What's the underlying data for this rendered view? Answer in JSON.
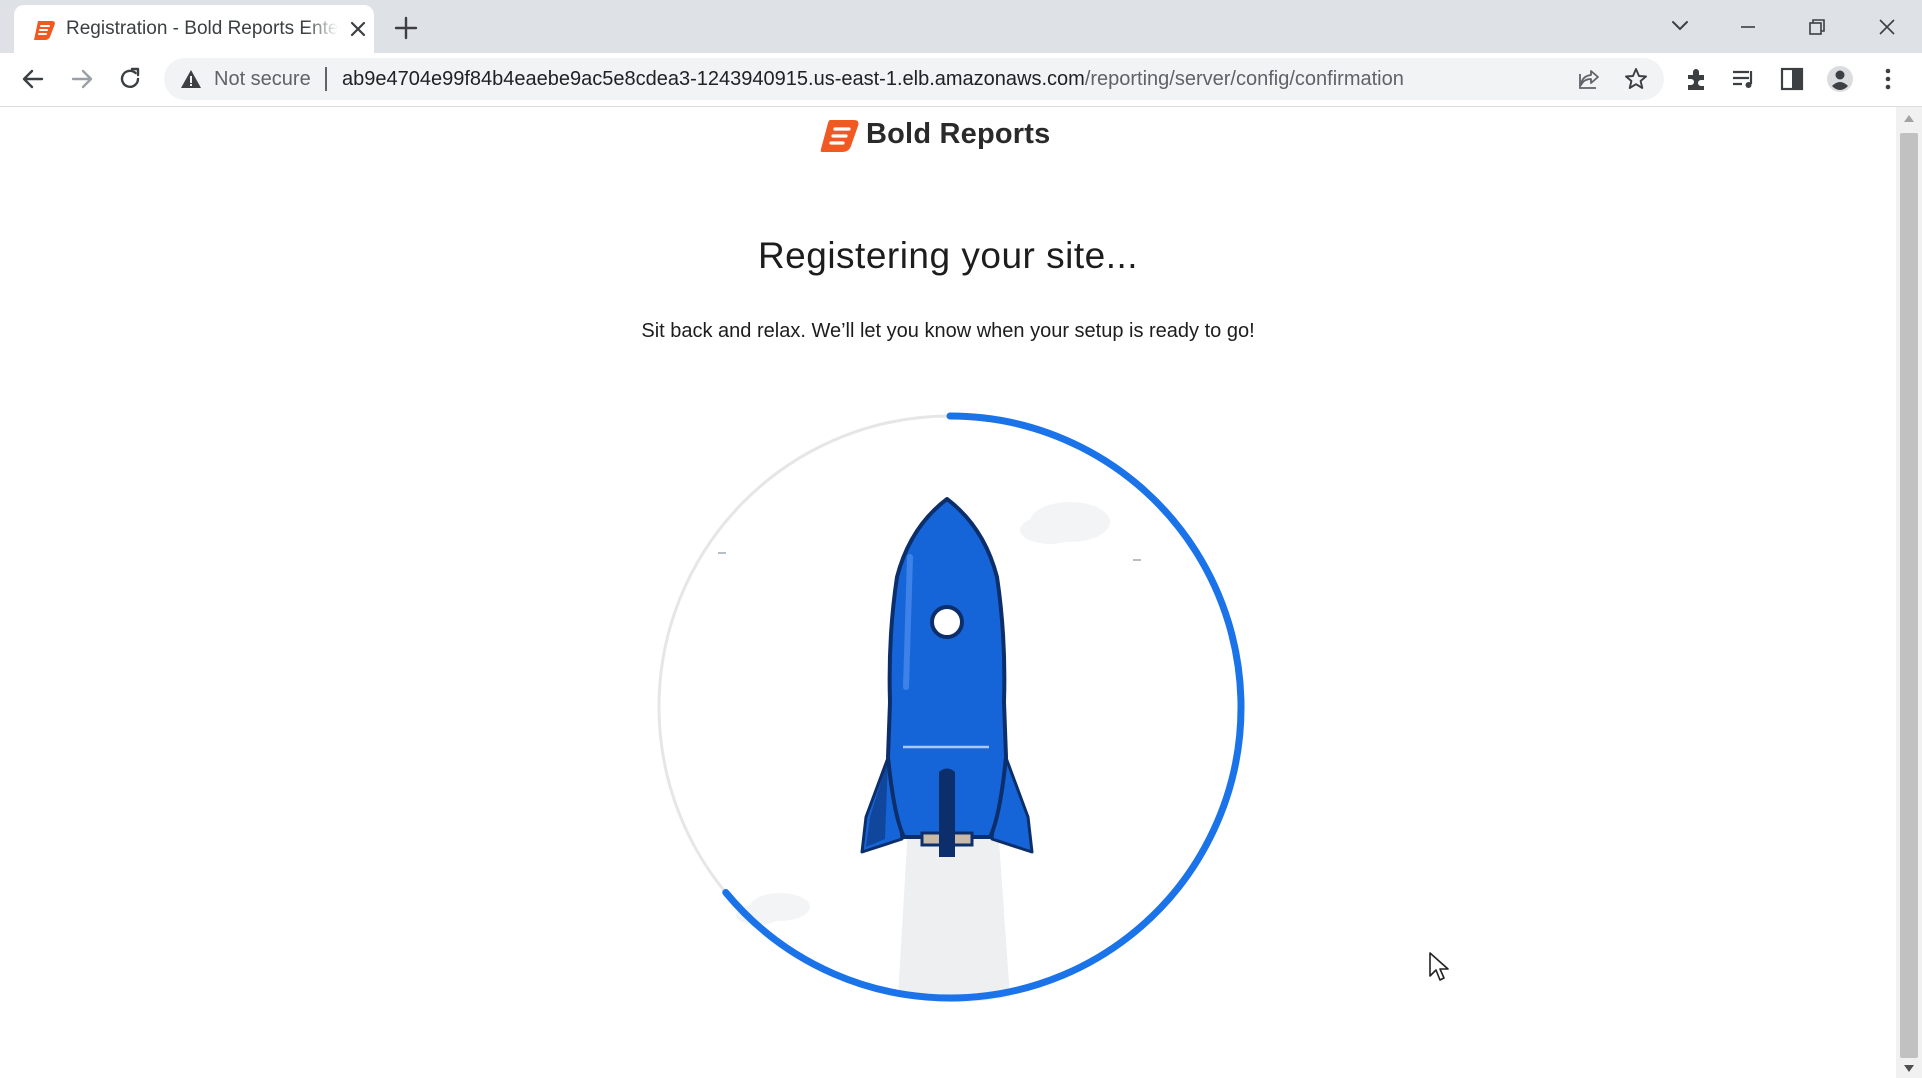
{
  "browser": {
    "tab": {
      "title": "Registration - Bold Reports Enterprise",
      "favicon": "bold-reports-icon"
    },
    "new_tab_icon": "plus-icon",
    "address_bar": {
      "security_label": "Not secure",
      "url_host": "ab9e4704e99f84b4eaebe9ac5e8cdea3-1243940915.us-east-1.elb.amazonaws.com",
      "url_path": "/reporting/server/config/confirmation"
    },
    "icons": [
      "back-icon",
      "forward-icon",
      "reload-icon",
      "warning-icon",
      "share-icon",
      "bookmark-star-icon",
      "extensions-icon",
      "media-control-icon",
      "side-panel-icon",
      "profile-icon",
      "menu-icon",
      "tab-search-icon",
      "minimize-icon",
      "restore-icon",
      "close-icon"
    ]
  },
  "page": {
    "brand": {
      "name": "Bold Reports"
    },
    "heading": "Registering your site...",
    "subtext": "Sit back and relax. We’ll let you know when your setup is ready to go!",
    "progress": {
      "fraction": 0.64,
      "color": "#1a73e8"
    }
  },
  "colors": {
    "accent": "#0d6efd",
    "brand_orange": "#f05a22",
    "rocket_blue": "#1565d8",
    "rocket_dark": "#0c2f6b"
  }
}
